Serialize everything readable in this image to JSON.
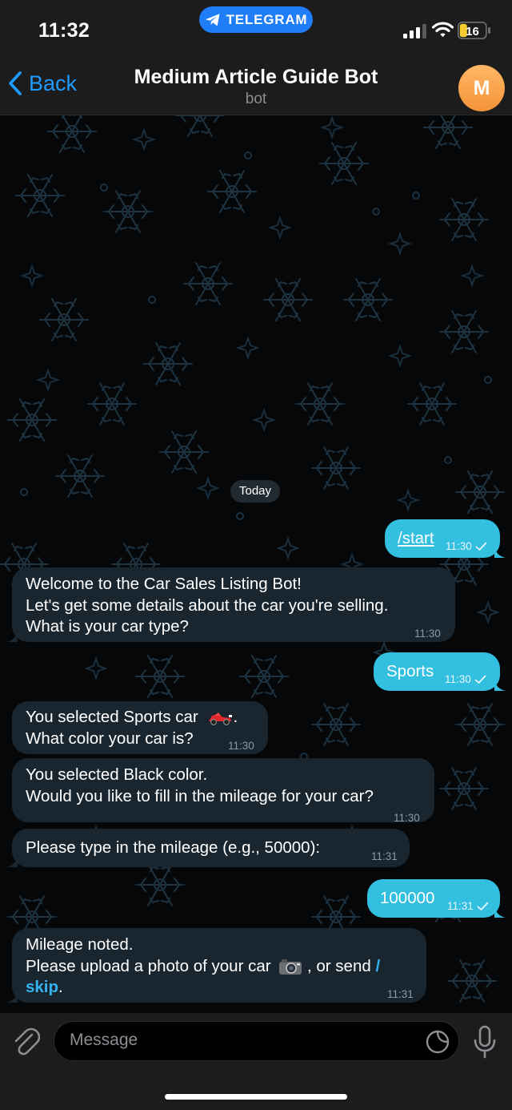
{
  "status_bar": {
    "time": "11:32",
    "app_pill": "TELEGRAM",
    "battery": "16"
  },
  "header": {
    "back_label": "Back",
    "title": "Medium Article Guide Bot",
    "subtitle": "bot",
    "avatar_initial": "M"
  },
  "chat": {
    "date_label": "Today",
    "messages": [
      {
        "direction": "outgoing",
        "text": "/start",
        "time": "11:30",
        "status": "sent"
      },
      {
        "direction": "incoming",
        "lines": [
          "Welcome to the Car Sales Listing Bot!",
          "Let's get some details about the car you're selling.",
          "What is your car type?"
        ],
        "time": "11:30"
      },
      {
        "direction": "outgoing",
        "text": "Sports",
        "time": "11:30",
        "status": "sent"
      },
      {
        "direction": "incoming",
        "lines": [
          "You selected Sports car",
          "What color your car is?"
        ],
        "emoji": "racing-car",
        "time": "11:30"
      },
      {
        "direction": "incoming",
        "lines": [
          "You selected Black color.",
          "Would you like to fill in the mileage for your car?"
        ],
        "time": "11:30"
      },
      {
        "direction": "incoming",
        "lines": [
          "Please type in the mileage (e.g., 50000):"
        ],
        "time": "11:31"
      },
      {
        "direction": "outgoing",
        "text": "100000",
        "time": "11:31",
        "status": "sent"
      },
      {
        "direction": "incoming",
        "lines": [
          "Mileage noted.",
          "Please upload a photo of your car",
          ", or send"
        ],
        "emoji": "camera",
        "command": "/skip",
        "command_parts": [
          "/",
          "skip"
        ],
        "trailing": ".",
        "time": "11:31"
      }
    ]
  },
  "input": {
    "placeholder": "Message"
  },
  "colors": {
    "accent": "#1e9bff",
    "outgoing_bubble": "#32bfe0",
    "incoming_bubble": "#1a262f",
    "avatar": "#f49438",
    "pill": "#1f7ef7"
  }
}
